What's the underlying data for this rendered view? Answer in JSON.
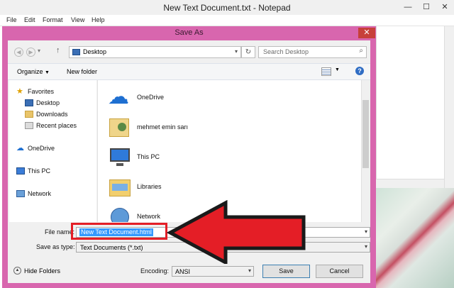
{
  "notepad": {
    "title": "New Text Document.txt - Notepad",
    "minimize": "—",
    "maximize": "☐",
    "close": "✕",
    "menu": [
      "File",
      "Edit",
      "Format",
      "View",
      "Help"
    ]
  },
  "dialog": {
    "title": "Save As",
    "close": "✕",
    "address": "Desktop",
    "search_placeholder": "Search Desktop",
    "toolbar": {
      "organize": "Organize",
      "new_folder": "New folder"
    },
    "nav": {
      "favorites": "Favorites",
      "favorites_items": [
        "Desktop",
        "Downloads",
        "Recent places"
      ],
      "onedrive": "OneDrive",
      "this_pc": "This PC",
      "network": "Network"
    },
    "files": [
      "OneDrive",
      "mehmet emin sarı",
      "This PC",
      "Libraries",
      "Network"
    ],
    "file_name_label": "File name:",
    "file_name_value": "New Text Document.html",
    "save_as_type_label": "Save as type:",
    "save_as_type_value": "Text Documents (*.txt)",
    "hide_folders": "Hide Folders",
    "encoding_label": "Encoding:",
    "encoding_value": "ANSI",
    "save": "Save",
    "cancel": "Cancel"
  },
  "colors": {
    "dialog_frame": "#d866ae",
    "close_button": "#c7403a",
    "highlight_arrow": "#e41e26",
    "selection": "#3399ff"
  }
}
